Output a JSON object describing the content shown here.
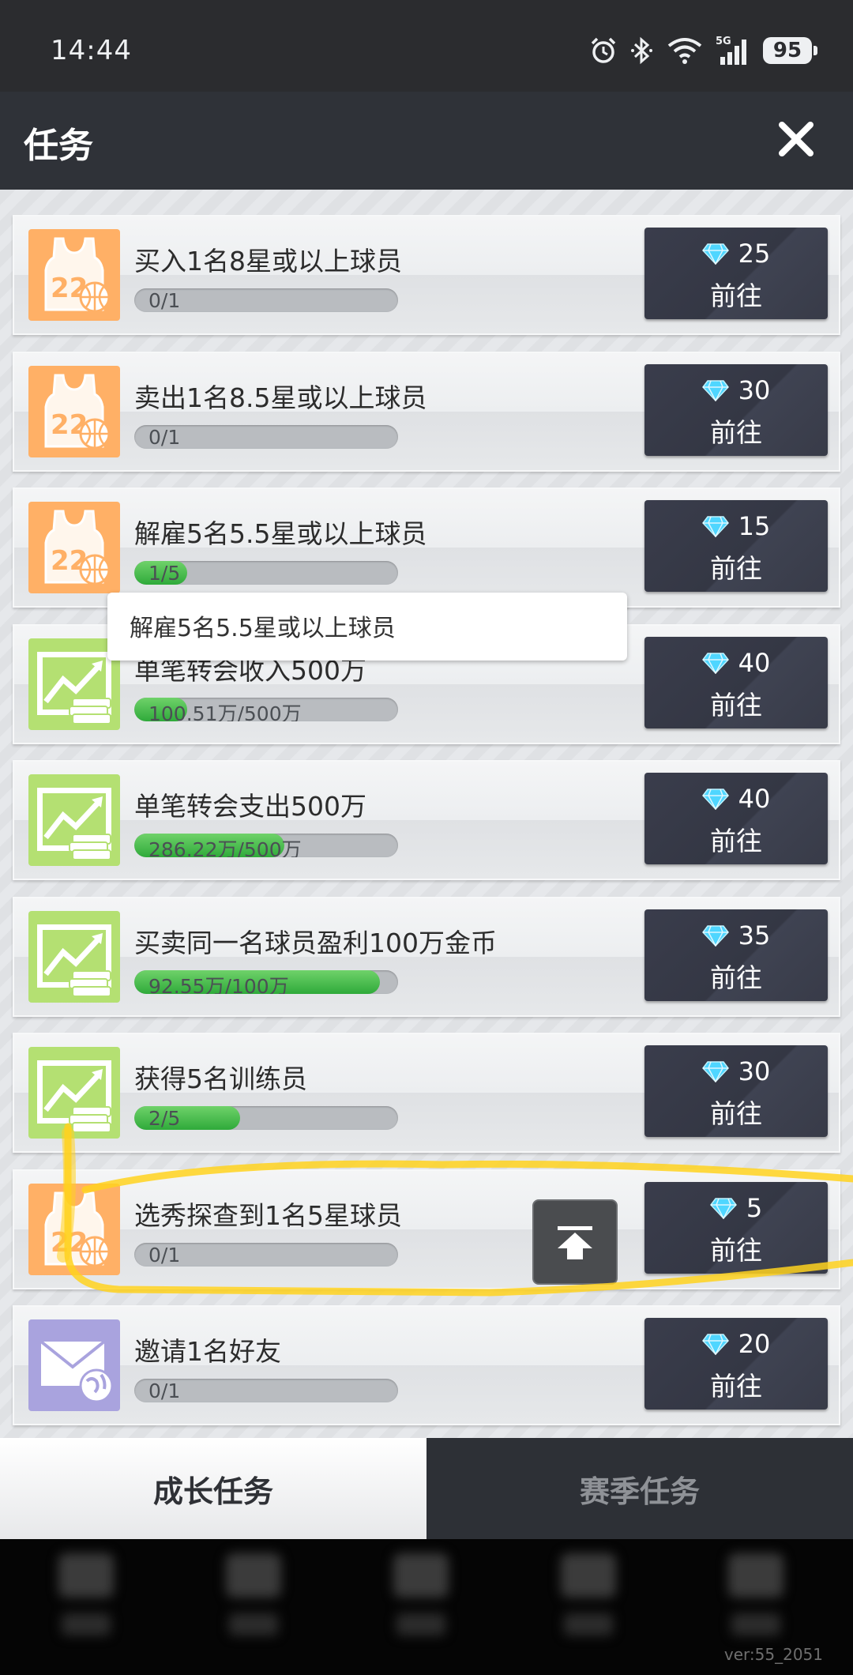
{
  "status_bar": {
    "time": "14:44",
    "network": "5G",
    "battery": "95",
    "icons": [
      "alarm-icon",
      "bluetooth-icon",
      "wifi-icon",
      "signal-icon",
      "battery-icon"
    ]
  },
  "header": {
    "title": "任务",
    "close_icon": "close-icon"
  },
  "tasks": [
    {
      "name": "买入1名8星或以上球员",
      "progress_text": "0/1",
      "progress": 0.0,
      "reward": "25",
      "button": "前往",
      "icon": "jersey-basketball-icon",
      "icon_color": "#ffb066"
    },
    {
      "name": "卖出1名8.5星或以上球员",
      "progress_text": "0/1",
      "progress": 0.0,
      "reward": "30",
      "button": "前往",
      "icon": "jersey-basketball-icon",
      "icon_color": "#ffb066"
    },
    {
      "name": "解雇5名5.5星或以上球员",
      "progress_text": "1/5",
      "progress": 0.2,
      "reward": "15",
      "button": "前往",
      "icon": "jersey-basketball-icon",
      "icon_color": "#ffb066"
    },
    {
      "name": "单笔转会收入500万",
      "progress_text": "100.51万/500万",
      "progress": 0.2,
      "reward": "40",
      "button": "前往",
      "icon": "money-growth-icon",
      "icon_color": "#b4e072"
    },
    {
      "name": "单笔转会支出500万",
      "progress_text": "286.22万/500万",
      "progress": 0.57,
      "reward": "40",
      "button": "前往",
      "icon": "money-growth-icon",
      "icon_color": "#b4e072"
    },
    {
      "name": "买卖同一名球员盈利100万金币",
      "progress_text": "92.55万/100万",
      "progress": 0.93,
      "reward": "35",
      "button": "前往",
      "icon": "money-growth-icon",
      "icon_color": "#b4e072"
    },
    {
      "name": "获得5名训练员",
      "progress_text": "2/5",
      "progress": 0.4,
      "reward": "30",
      "button": "前往",
      "icon": "money-growth-icon",
      "icon_color": "#b4e072"
    },
    {
      "name": "选秀探查到1名5星球员",
      "progress_text": "0/1",
      "progress": 0.0,
      "reward": "5",
      "button": "前往",
      "icon": "jersey-basketball-icon",
      "icon_color": "#ffb066"
    },
    {
      "name": "邀请1名好友",
      "progress_text": "0/1",
      "progress": 0.0,
      "reward": "20",
      "button": "前往",
      "icon": "mail-globe-icon",
      "icon_color": "#a9a3de"
    }
  ],
  "tooltip": {
    "text": "解雇5名5.5星或以上球员"
  },
  "reward_icon": "diamond-icon",
  "tabs": [
    {
      "label": "成长任务",
      "active": true
    },
    {
      "label": "赛季任务",
      "active": false
    }
  ],
  "footer": {
    "version": "ver:55_2051"
  },
  "colors": {
    "header_bg": "#2f3238",
    "button_bg": "#383b48",
    "progress_fill": "#3fbe48",
    "annotation": "#ffd21f"
  }
}
